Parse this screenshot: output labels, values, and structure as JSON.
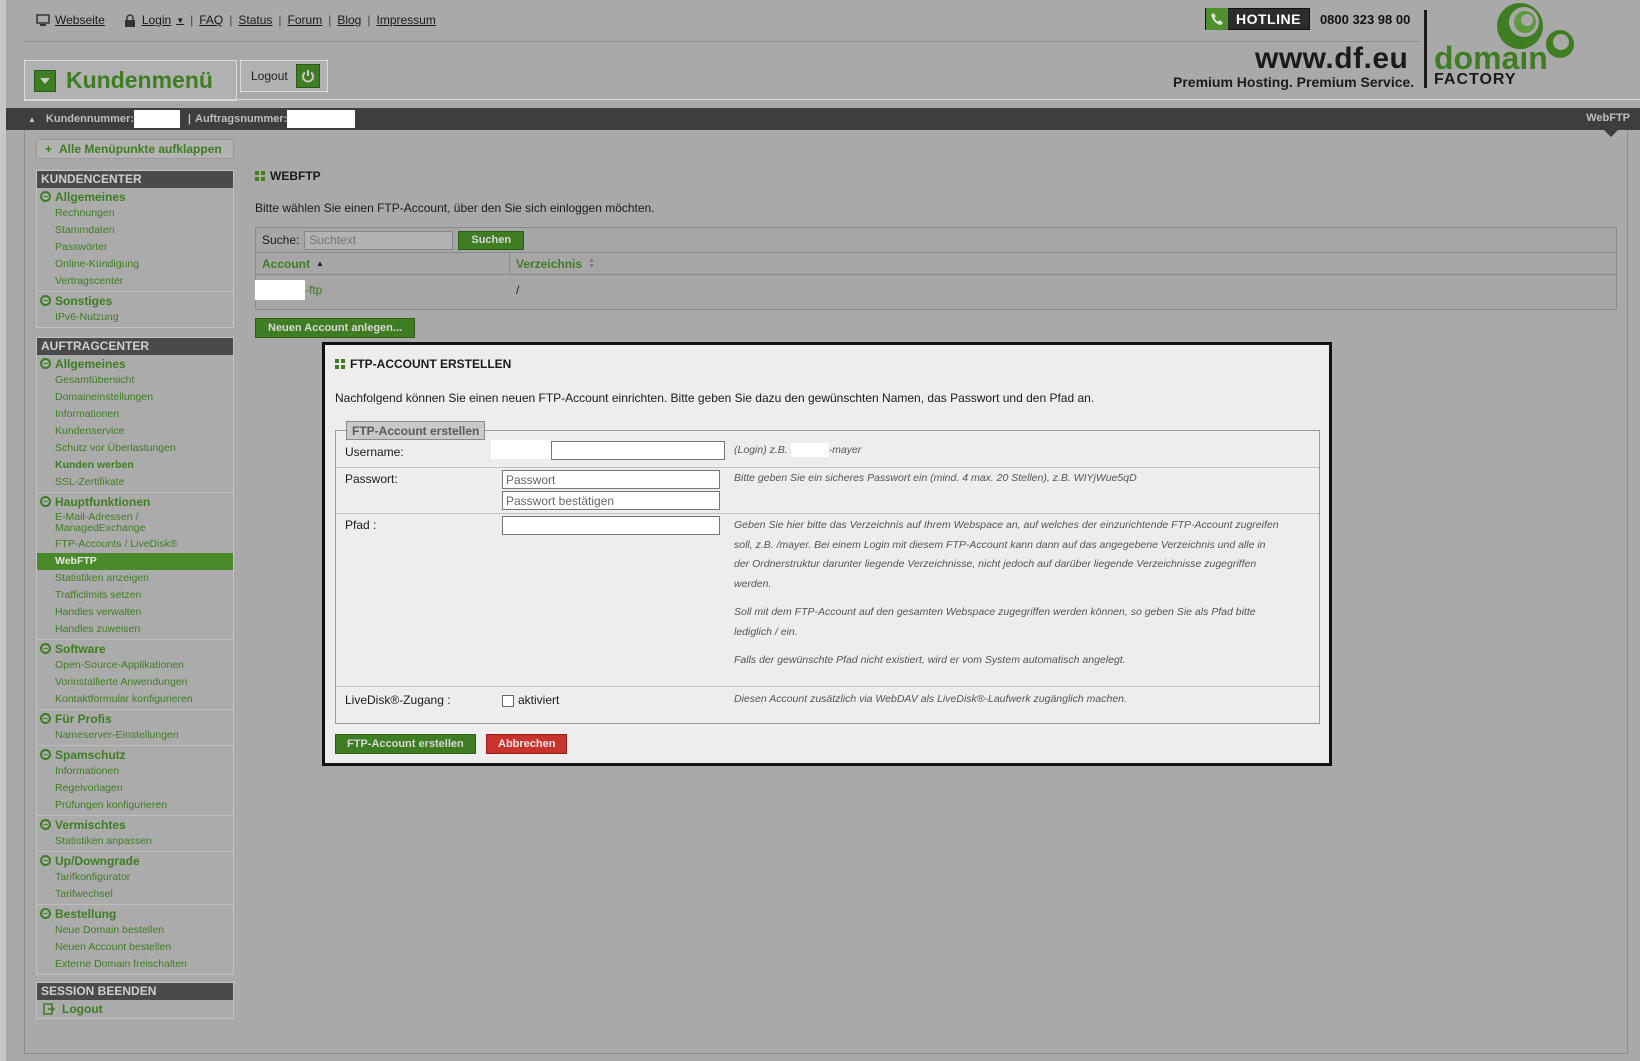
{
  "topnav": {
    "webseite": "Webseite",
    "login": "Login",
    "faq": "FAQ",
    "status": "Status",
    "forum": "Forum",
    "blog": "Blog",
    "impressum": "Impressum"
  },
  "hotline": {
    "label": "HOTLINE",
    "number": "0800 323 98 00"
  },
  "brand": {
    "www": "www.df.eu",
    "tagline": "Premium Hosting. Premium Service.",
    "domain": "domain",
    "factory": "FACTORY",
    "green": "#3f7d22"
  },
  "header": {
    "kundenmenu": "Kundenmenü",
    "logout": "Logout"
  },
  "strip": {
    "kundennummer": "Kundennummer:",
    "auftragsnummer": "Auftragsnummer:",
    "current": "WebFTP"
  },
  "sidebar": {
    "expand_all": "Alle Menüpunkte aufklappen",
    "kundencenter": {
      "title": "KUNDENCENTER",
      "groups": [
        {
          "title": "Allgemeines",
          "items": [
            "Rechnungen",
            "Stammdaten",
            "Passwörter",
            "Online-Kündigung",
            "Vertragscenter"
          ]
        },
        {
          "title": "Sonstiges",
          "items": [
            "IPv6-Nutzung"
          ]
        }
      ]
    },
    "auftragcenter": {
      "title": "AUFTRAGCENTER",
      "groups": [
        {
          "title": "Allgemeines",
          "items": [
            "Gesamtübersicht",
            "Domaineinstellungen",
            "Informationen",
            "Kundenservice",
            "Schutz vor Überlastungen",
            "Kunden werben",
            "SSL-Zertifikate"
          ]
        },
        {
          "title": "Hauptfunktionen",
          "items": [
            "E-Mail-Adressen / ManagedExchange",
            "FTP-Accounts / LiveDisk®",
            "WebFTP",
            "Statistiken anzeigen",
            "Trafficlimits setzen",
            "Handles verwalten",
            "Handles zuweisen"
          ]
        },
        {
          "title": "Software",
          "items": [
            "Open-Source-Applikationen",
            "Vorinstallierte Anwendungen",
            "Kontaktformular konfigurieren"
          ]
        },
        {
          "title": "Für Profis",
          "items": [
            "Nameserver-Einstellungen"
          ]
        },
        {
          "title": "Spamschutz",
          "items": [
            "Informationen",
            "Regelvorlagen",
            "Prüfungen konfigurieren"
          ]
        },
        {
          "title": "Vermischtes",
          "items": [
            "Statistiken anpassen"
          ]
        },
        {
          "title": "Up/Downgrade",
          "items": [
            "Tarifkonfigurator",
            "Tarifwechsel"
          ]
        },
        {
          "title": "Bestellung",
          "items": [
            "Neue Domain bestellen",
            "Neuen Account bestellen",
            "Externe Domain freischalten"
          ]
        }
      ]
    },
    "session": {
      "title": "SESSION BEENDEN",
      "logout": "Logout"
    }
  },
  "main": {
    "title": "WEBFTP",
    "intro": "Bitte wählen Sie einen FTP-Account, über den Sie sich einloggen möchten.",
    "search_label": "Suche:",
    "search_placeholder": "Suchtext",
    "search_button": "Suchen",
    "col_account": "Account",
    "col_verzeichnis": "Verzeichnis",
    "row_account_suffix": "-ftp",
    "row_dir": "/",
    "new_account_button": "Neuen Account anlegen..."
  },
  "modal": {
    "title": "FTP-ACCOUNT ERSTELLEN",
    "intro": "Nachfolgend können Sie einen neuen FTP-Account einrichten. Bitte geben Sie dazu den gewünschten Namen, das Passwort und den Pfad an.",
    "legend": "FTP-Account erstellen",
    "username_label": "Username:",
    "username_hint_pre": "(Login) z.B.",
    "username_hint_post": "-mayer",
    "password_label": "Passwort:",
    "password_placeholder": "Passwort",
    "password_confirm_placeholder": "Passwort bestätigen",
    "password_hint": "Bitte geben Sie ein sicheres Passwort ein (mind. 4 max. 20 Stellen), z.B. WIYjWue5qD",
    "path_label": "Pfad :",
    "path_hint_1": "Geben Sie hier bitte das Verzeichnis auf Ihrem Webspace an, auf welches der einzurichtende FTP-Account zugreifen soll, z.B. /mayer. Bei einem Login mit diesem FTP-Account kann dann auf das angegebene Verzeichnis und alle in der Ordnerstruktur darunter liegende Verzeichnisse, nicht jedoch auf darüber liegende Verzeichnisse zugegriffen werden.",
    "path_hint_2": "Soll mit dem FTP-Account auf den gesamten Webspace zugegriffen werden können, so geben Sie als Pfad bitte lediglich / ein.",
    "path_hint_3": "Falls der gewünschte Pfad nicht existiert, wird er vom System automatisch angelegt.",
    "livedisk_label": "LiveDisk®-Zugang :",
    "livedisk_checkbox": "aktiviert",
    "livedisk_hint": "Diesen Account zusätzlich via WebDAV als LiveDisk®-Laufwerk zugänglich machen.",
    "create_button": "FTP-Account erstellen",
    "cancel_button": "Abbrechen"
  }
}
